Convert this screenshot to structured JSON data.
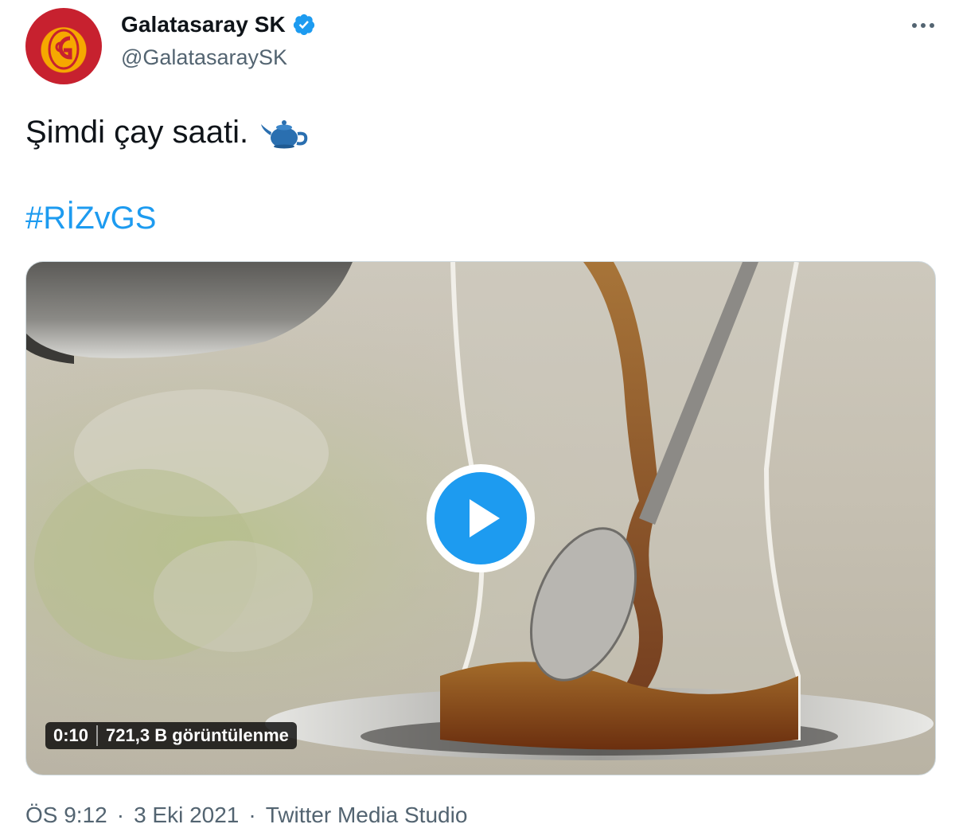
{
  "account": {
    "display_name": "Galatasaray SK",
    "handle": "@GalatasaraySK",
    "verified": true,
    "avatar_icon": "galatasaray-crest-icon"
  },
  "tweet": {
    "text": "Şimdi çay saati.",
    "emoji_icon": "teapot-icon",
    "hashtag": "#RİZvGS"
  },
  "media": {
    "type": "video",
    "duration": "0:10",
    "views": "721,3 B görüntülenme",
    "play_icon": "play-icon"
  },
  "meta": {
    "time": "ÖS 9:12",
    "separator": "·",
    "date": "3 Eki 2021",
    "source": "Twitter Media Studio"
  },
  "colors": {
    "link": "#1d9bf0",
    "text_primary": "#0f1419",
    "text_secondary": "#536471",
    "club_red": "#c7212f",
    "club_yellow": "#f6a800"
  }
}
